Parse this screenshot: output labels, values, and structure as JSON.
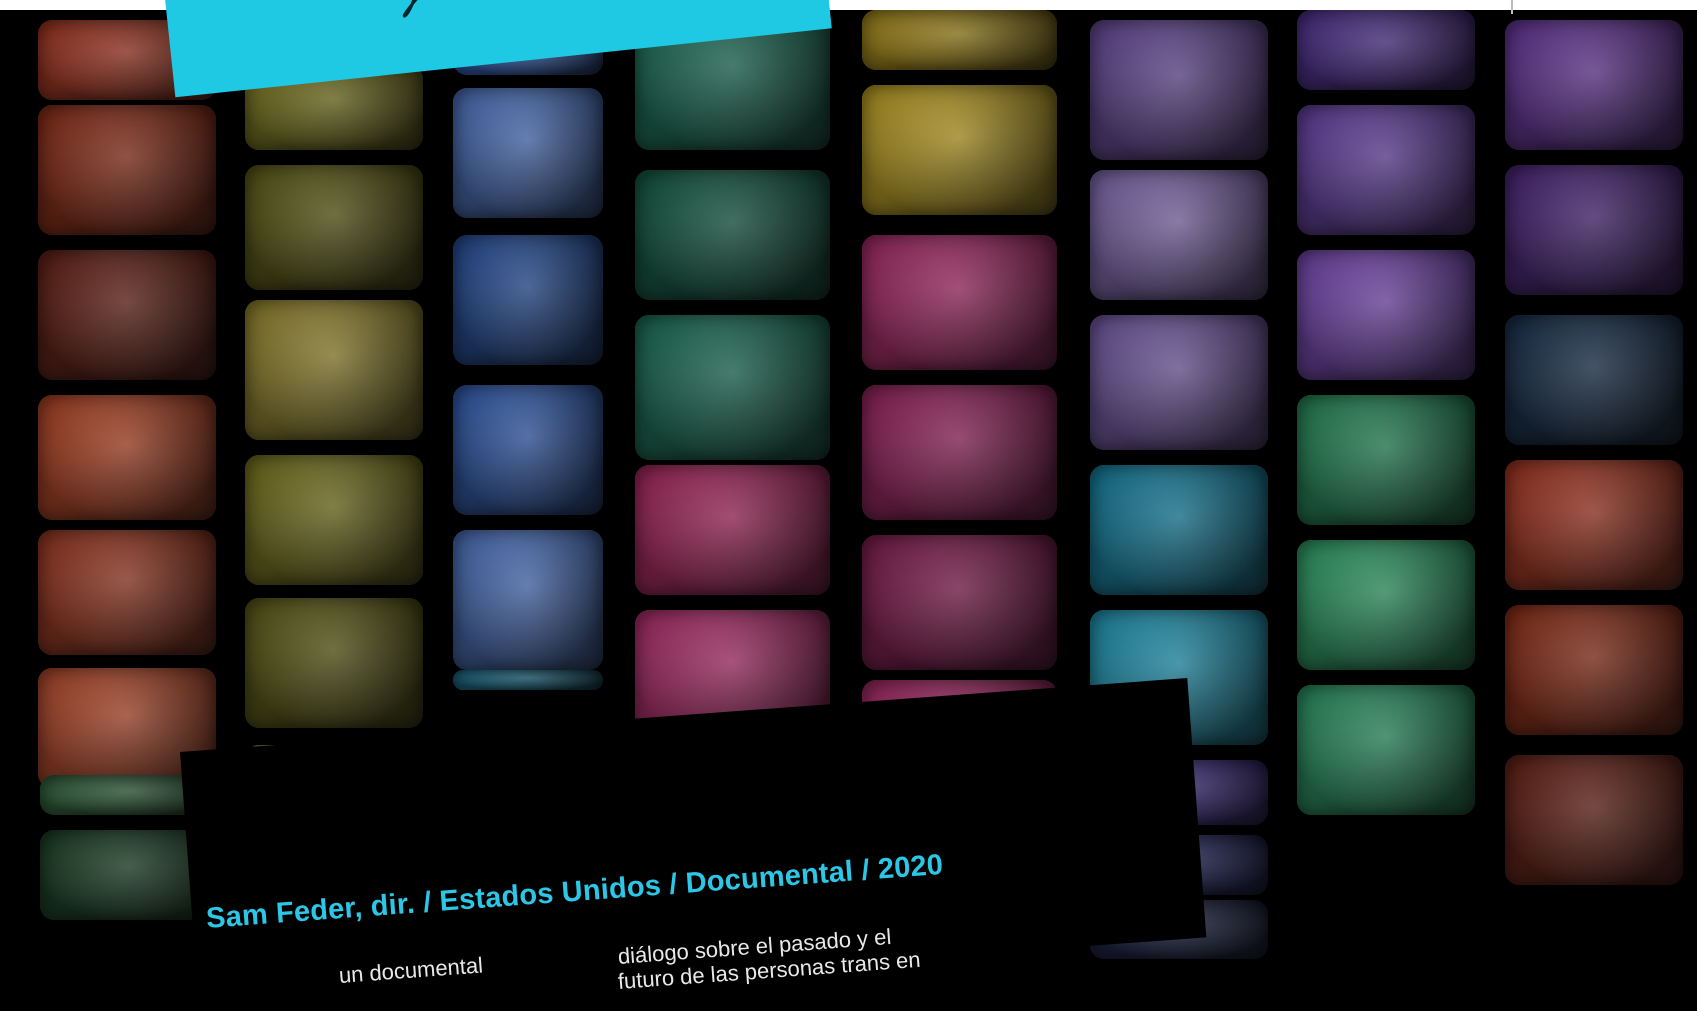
{
  "credits": {
    "line": "Sam Feder, dir.  / Estados Unidos  / Documental / 2020"
  },
  "synopsis": {
    "left_fragment": "un documental",
    "right_line1": "diálogo sobre el pasado y el",
    "right_line2": "futuro de las personas trans en"
  },
  "colors": {
    "banner": "#1fc8e3",
    "credits_text": "#2cc6e6"
  },
  "tile_colors": [
    [
      "#c2422a",
      "#a8391f",
      "#7a2a1d"
    ],
    [
      "#d3532e",
      "#b9452a",
      "#d65a36"
    ],
    [
      "#8e8a26",
      "#6f6d1c",
      "#b2a13a"
    ],
    [
      "#3b7447",
      "#234f2f"
    ],
    [
      "#3d3a18",
      "#7b7321",
      "#a89a33"
    ],
    [
      "#3d6fcf",
      "#5b88e0",
      "#2f5fb6"
    ],
    [
      "#1f7fa0",
      "#2a99b6"
    ],
    [
      "#23856a",
      "#1a6d54"
    ],
    [
      "#c83271",
      "#d23a83",
      "#b12b66"
    ],
    [
      "#c0a020",
      "#e0be2c"
    ],
    [
      "#c7357e",
      "#b42d73",
      "#9b2561"
    ],
    [
      "#7c5bb5",
      "#9b80d0",
      "#8c6ec4"
    ],
    [
      "#1d9bc0",
      "#2ab5d7"
    ],
    [
      "#4e3aa0",
      "#2b2d74",
      "#232a52"
    ],
    [
      "#5d3aa6",
      "#7a4fc1",
      "#8f59d4"
    ],
    [
      "#2fa36b",
      "#3abd7c",
      "#35b077"
    ],
    [
      "#7a43b6",
      "#5a2f8f",
      "#1f3a5b"
    ]
  ]
}
